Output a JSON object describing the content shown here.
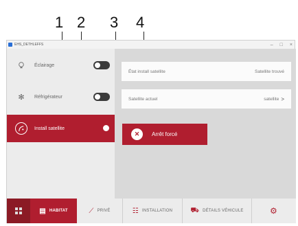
{
  "callouts": [
    "1",
    "2",
    "3",
    "4"
  ],
  "window": {
    "title": "EHS_DETHLEFFS",
    "controls": {
      "minimize": "–",
      "maximize": "□",
      "close": "×"
    }
  },
  "sidebar": {
    "items": [
      {
        "label": "Éclairage",
        "icon": "lightbulb-icon",
        "toggle": false
      },
      {
        "label": "Réfrigérateur",
        "icon": "snowflake-icon",
        "toggle": false
      },
      {
        "label": "Install satellite",
        "icon": "satellite-icon",
        "toggle": true
      }
    ]
  },
  "main": {
    "status_row": {
      "label": "État install satellite",
      "value": "Satellite trouvé"
    },
    "current_row": {
      "label": "Satellite actuel",
      "value": "satellite"
    },
    "stop_button": {
      "label": "Arrêt forcé",
      "icon": "close-icon"
    }
  },
  "bottom_nav": {
    "items": [
      {
        "label": "HABITAT",
        "icon": "habitat-icon"
      },
      {
        "label": "PRIVÉ",
        "icon": "prive-icon"
      },
      {
        "label": "INSTALLATION",
        "icon": "installation-icon"
      },
      {
        "label": "DÉTAILS VÉHICULE",
        "icon": "vehicle-icon"
      }
    ]
  },
  "colors": {
    "accent": "#b01e2f",
    "panel": "#d9d9d9",
    "sidebar": "#ececec"
  }
}
